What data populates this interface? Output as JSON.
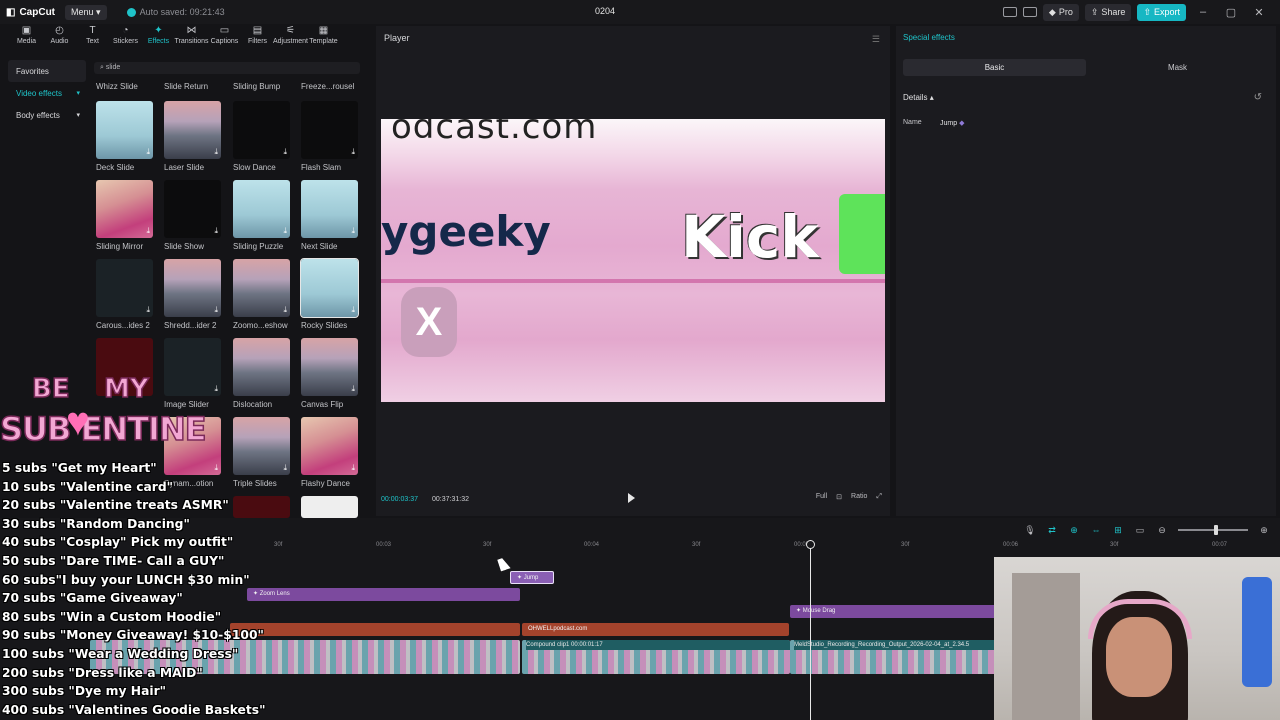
{
  "titlebar": {
    "logo": "CapCut",
    "menu": "Menu",
    "autosave": "Auto saved: 09:21:43",
    "project_name": "0204",
    "pro": "Pro",
    "share": "Share",
    "export": "Export"
  },
  "toolbar": {
    "items": [
      "Media",
      "Audio",
      "Text",
      "Stickers",
      "Effects",
      "Transitions",
      "Captions",
      "Filters",
      "Adjustment",
      "Template"
    ],
    "active": "Effects"
  },
  "sidebar": {
    "favorites": "Favorites",
    "video_effects": "Video effects",
    "body_effects": "Body effects"
  },
  "search": {
    "value": "slide"
  },
  "effects": [
    "Whizz Slide",
    "Slide Return",
    "Sliding Bump",
    "Freeze...rousel",
    "Deck Slide",
    "Laser Slide",
    "Slow Dance",
    "Flash Slam",
    "Sliding Mirror",
    "Slide Show",
    "Sliding Puzzle",
    "Next Slide",
    "Carous...ides 2",
    "Shredd...ider 2",
    "Zoomo...eshow",
    "Rocky Slides",
    "Image Slider",
    "Dislocation",
    "Canvas Flip",
    "Dynam...otion",
    "Triple Slides",
    "Flashy Dance"
  ],
  "player": {
    "title": "Player",
    "current_time": "00:00:03:37",
    "total_time": "00:37:31:32",
    "ctrl_full": "Full",
    "ctrl_ratio": "Ratio",
    "video_url": "odcast.com",
    "video_text1": "ygeeky",
    "video_text2": "Kick"
  },
  "right_panel": {
    "title": "Special effects",
    "tab_basic": "Basic",
    "tab_mask": "Mask",
    "details": "Details",
    "name_label": "Name",
    "name_value": "Jump"
  },
  "timeline": {
    "ruler": [
      "30f",
      "00:03",
      "30f",
      "00:04",
      "30f",
      "00:05",
      "30f",
      "00:06",
      "30f",
      "00:07"
    ],
    "clips": {
      "jump": "Jump",
      "zoom_lens": "Zoom Lens",
      "mouse_drag": "Mouse Drag",
      "ohwell": "OHWELLpodcast.com",
      "compound": "Compound clip1  00:00:01:17",
      "recording": "MeldStudio_Recording_Recording_Output_2026-02-04_at_2.34.5"
    }
  },
  "overlay": {
    "sticker_be": "BE",
    "sticker_my": "MY",
    "sticker_sub": "SUB ENTINE",
    "goals": [
      "5 subs \"Get my Heart\"",
      "10 subs \"Valentine card\"",
      "20 subs \"Valentine treats ASMR\"",
      "30 subs \"Random Dancing\"",
      "40 subs \"Cosplay\" Pick my outfit\"",
      "50 subs \"Dare TIME- Call a GUY\"",
      "60 subs\"I buy your LUNCH $30 min\"",
      "70 subs \"Game Giveaway\"",
      "80 subs \"Win a Custom Hoodie\"",
      "90 subs \"Money Giveaway! $10-$100\"",
      "100 subs \"Wear a Wedding Dress\"",
      "200 subs \"Dress like a MAID\"",
      "300 subs \"Dye my Hair\"",
      "400 subs \"Valentines Goodie Baskets\""
    ]
  },
  "colors": {
    "accent": "#1fc3c9",
    "clip_purple": "#7c4a9e",
    "clip_orange": "#a4432c"
  }
}
